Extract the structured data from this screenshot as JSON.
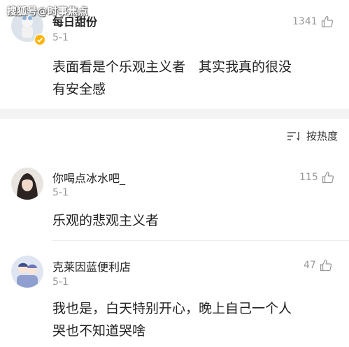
{
  "watermark": "搜狐号@时事焦点",
  "top_comment": {
    "username": "每日甜份",
    "date": "5-1",
    "likes": "1341",
    "text_line1": "表面看是个乐观主义者　其实我真的很没",
    "text_line2": "有安全感"
  },
  "sort": {
    "label": "按热度"
  },
  "comments": [
    {
      "username": "你喝点冰水吧_",
      "date": "5-1",
      "likes": "115",
      "text_line1": "乐观的悲观主义者"
    },
    {
      "username": "克莱因蓝便利店",
      "date": "5-1",
      "likes": "47",
      "text_line1": "我也是，白天特别开心，晚上自己一个人",
      "text_line2": "哭也不知道哭啥"
    }
  ]
}
